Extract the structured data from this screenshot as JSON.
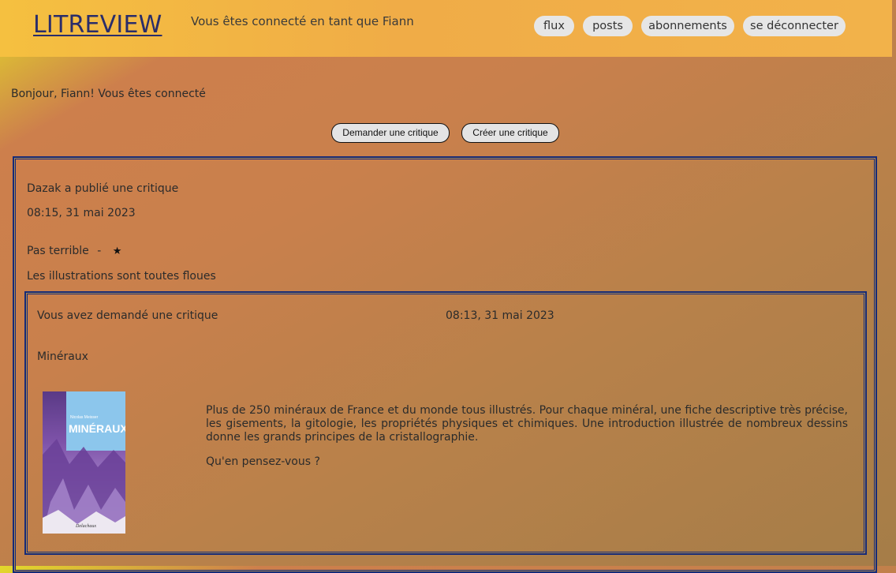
{
  "header": {
    "logo": "LITREVIEW",
    "connected_text": "Vous êtes connecté en tant que Fiann",
    "nav": [
      "flux",
      "posts",
      "abonnements",
      "se déconnecter"
    ]
  },
  "greeting": "Bonjour, Fiann! Vous êtes connecté",
  "actions": {
    "request_label": "Demander une critique",
    "create_label": "Créer une critique"
  },
  "review": {
    "author_line": "Dazak a publié une critique",
    "date": "08:15, 31 mai 2023",
    "headline": "Pas terrible",
    "separator": "-",
    "rating_stars": "★",
    "body": "Les illustrations sont toutes floues",
    "ticket": {
      "author_line": "Vous avez demandé une critique",
      "date": "08:13, 31 mai 2023",
      "title": "Minéraux",
      "cover_text": "MINÉRAUX",
      "cover_small": "Nicolas Meisser",
      "cover_publisher": "Delachaux",
      "description": "Plus de 250 minéraux de France et du monde tous illustrés. Pour chaque minéral, une fiche descriptive très précise, les gisements, la gitologie, les propriétés physiques et chimiques. Une introduction illustrée de nombreux dessins donne les grands principes de la cristallographie.",
      "question": "Qu'en pensez-vous ?"
    }
  }
}
